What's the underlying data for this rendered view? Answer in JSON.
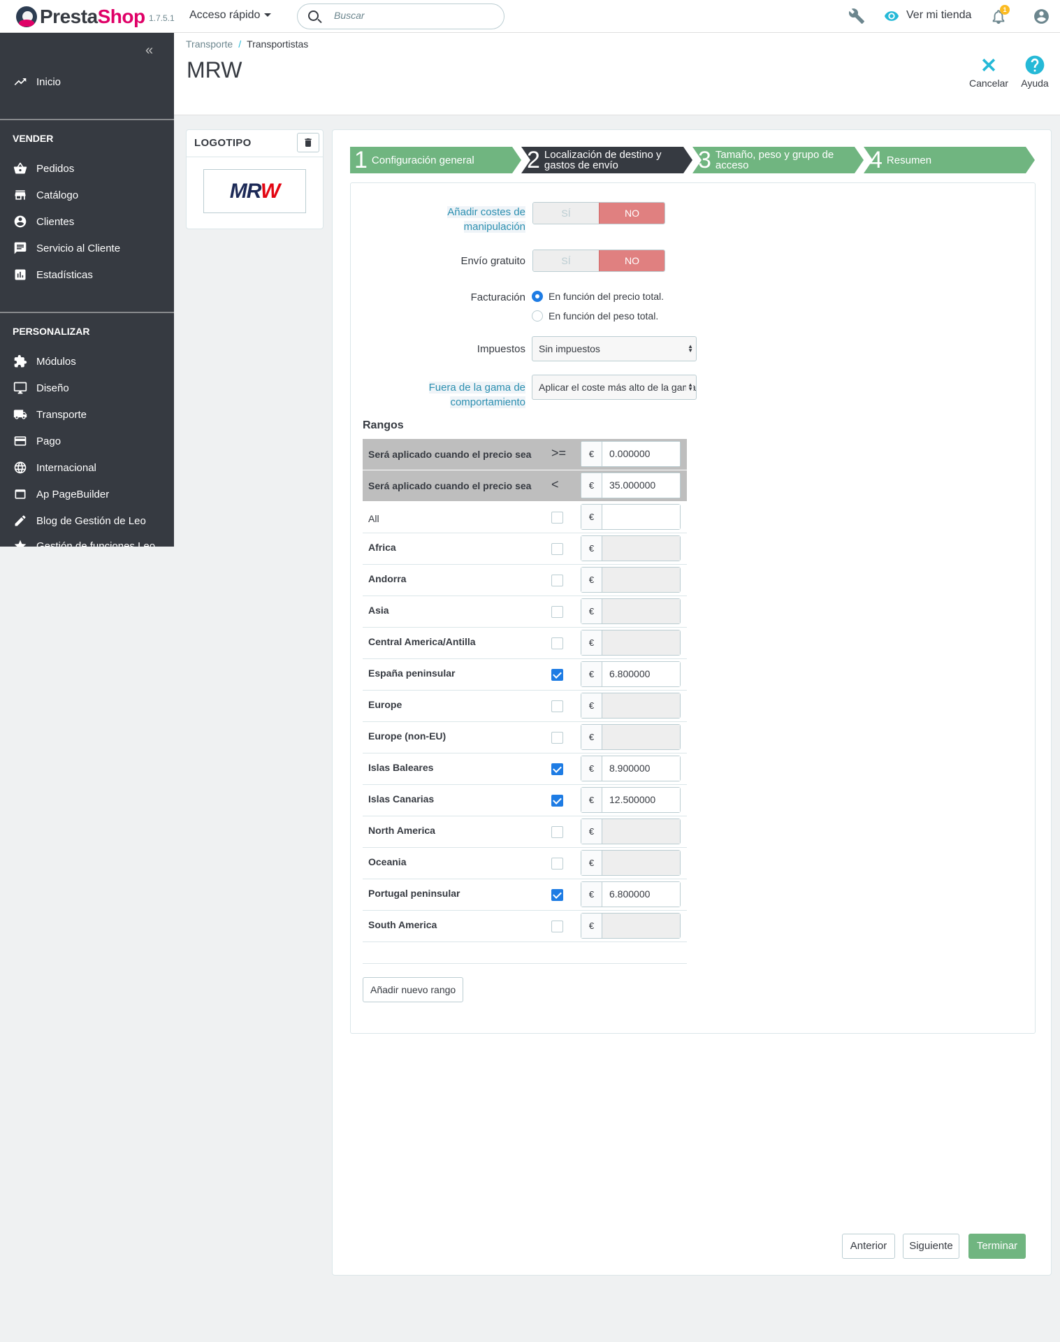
{
  "header": {
    "logo_part1": "Presta",
    "logo_part2": "Shop",
    "version": "1.7.5.1",
    "quick_access": "Acceso rápido",
    "search_placeholder": "Buscar",
    "view_store": "Ver mi tienda",
    "notification_count": "1"
  },
  "sidebar": {
    "home": "Inicio",
    "section_sell": "VENDER",
    "sell_items": [
      "Pedidos",
      "Catálogo",
      "Clientes",
      "Servicio al Cliente",
      "Estadísticas"
    ],
    "section_custom": "PERSONALIZAR",
    "custom_items": [
      "Módulos",
      "Diseño",
      "Transporte",
      "Pago",
      "Internacional",
      "Ap PageBuilder",
      "Blog de Gestión de Leo",
      "Gestión de funciones Leo"
    ]
  },
  "breadcrumb": {
    "parent": "Transporte",
    "separator": "/",
    "current": "Transportistas"
  },
  "page_title": "MRW",
  "header_buttons": {
    "cancel": "Cancelar",
    "help": "Ayuda"
  },
  "logo_card": {
    "title": "LOGOTIPO",
    "logo_part1": "MR",
    "logo_part2": "W"
  },
  "steps": [
    {
      "num": "1",
      "label": "Configuración general"
    },
    {
      "num": "2",
      "label": "Localización de destino y gastos de envío"
    },
    {
      "num": "3",
      "label": "Tamaño, peso y grupo de acceso"
    },
    {
      "num": "4",
      "label": "Resumen"
    }
  ],
  "form": {
    "handling_label": "Añadir costes de manipulación",
    "free_label": "Envío gratuito",
    "switch_yes": "SÍ",
    "switch_no": "NO",
    "billing_label": "Facturación",
    "billing_opt1": "En función del precio total.",
    "billing_opt2": "En función del peso total.",
    "tax_label": "Impuestos",
    "tax_value": "Sin impuestos",
    "oor_label": "Fuera de la gama de comportamiento",
    "oor_value": "Aplicar el coste más alto de la gama definida"
  },
  "ranges": {
    "title": "Rangos",
    "row1_label": "Será aplicado cuando el precio sea",
    "row1_op": ">=",
    "row1_value": "0.000000",
    "row2_label": "Será aplicado cuando el precio sea",
    "row2_op": "<",
    "row2_value": "35.000000",
    "currency": "€",
    "zones": [
      {
        "name": "All",
        "checked": false,
        "value": ""
      },
      {
        "name": "Africa",
        "checked": false,
        "value": ""
      },
      {
        "name": "Andorra",
        "checked": false,
        "value": ""
      },
      {
        "name": "Asia",
        "checked": false,
        "value": ""
      },
      {
        "name": "Central America/Antilla",
        "checked": false,
        "value": ""
      },
      {
        "name": "España peninsular",
        "checked": true,
        "value": "6.800000"
      },
      {
        "name": "Europe",
        "checked": false,
        "value": ""
      },
      {
        "name": "Europe (non-EU)",
        "checked": false,
        "value": ""
      },
      {
        "name": "Islas Baleares",
        "checked": true,
        "value": "8.900000"
      },
      {
        "name": "Islas Canarias",
        "checked": true,
        "value": "12.500000"
      },
      {
        "name": "North America",
        "checked": false,
        "value": ""
      },
      {
        "name": "Oceania",
        "checked": false,
        "value": ""
      },
      {
        "name": "Portugal peninsular",
        "checked": true,
        "value": "6.800000"
      },
      {
        "name": "South America",
        "checked": false,
        "value": ""
      }
    ],
    "add_button": "Añadir nuevo rango"
  },
  "footer": {
    "prev": "Anterior",
    "next": "Siguiente",
    "finish": "Terminar"
  },
  "colors": {
    "sidebar_bg": "#363a41",
    "accent": "#25b9d7",
    "step_green": "#70b580",
    "step_dark": "#363a41",
    "switch_no": "#e08080",
    "checkbox_blue": "#1e7ce4"
  }
}
